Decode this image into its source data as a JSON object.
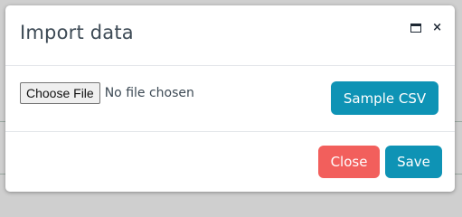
{
  "dialog": {
    "title": "Import data"
  },
  "icons": {
    "maximize": "window-maximize-icon",
    "close": "close-icon",
    "close_symbol": "×"
  },
  "file_input": {
    "button_label": "Choose File",
    "status_text": "No file chosen"
  },
  "buttons": {
    "sample_csv": "Sample CSV",
    "close": "Close",
    "save": "Save"
  },
  "colors": {
    "primary": "#0e93b5",
    "danger": "#f25f5c",
    "title_text": "#3d4a55"
  }
}
